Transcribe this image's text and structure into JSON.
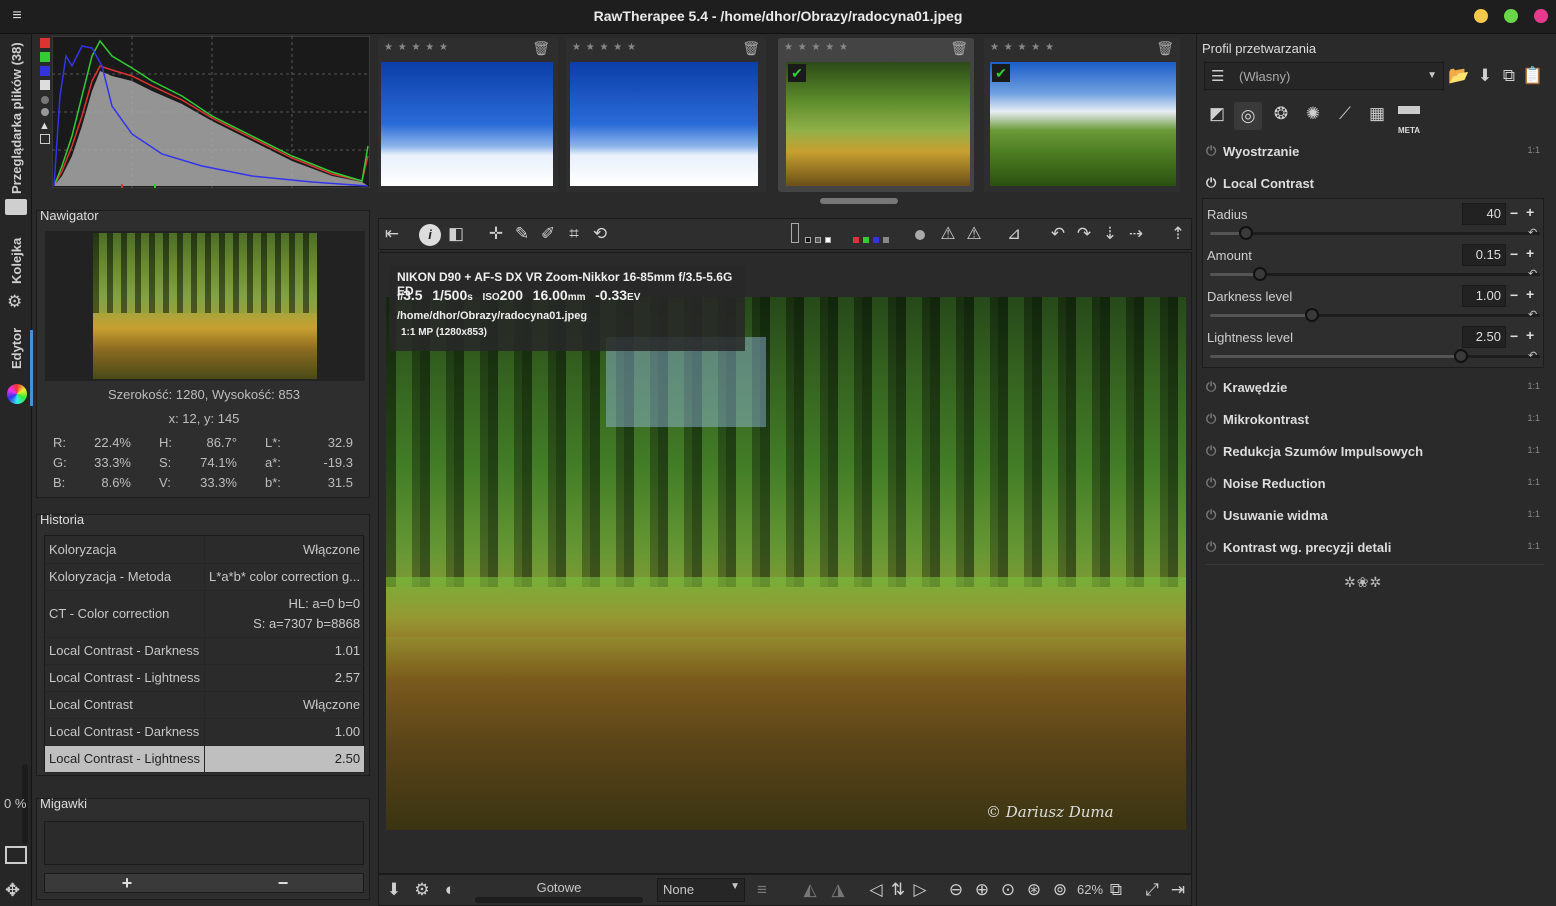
{
  "window": {
    "title": "RawTherapee 5.4 - /home/dhor/Obrazy/radocyna01.jpeg"
  },
  "left_tabs": {
    "browser": "Przeglądarka plików (38)",
    "queue": "Kolejka",
    "editor": "Edytor",
    "progress": "0 %"
  },
  "navigator": {
    "title": "Nawigator",
    "size": "Szerokość: 1280, Wysokość: 853",
    "coords": "x: 12, y: 145",
    "rows": [
      {
        "k1": "R:",
        "v1": "22.4%",
        "k2": "H:",
        "v2": "86.7°",
        "k3": "L*:",
        "v3": "32.9"
      },
      {
        "k1": "G:",
        "v1": "33.3%",
        "k2": "S:",
        "v2": "74.1%",
        "k3": "a*:",
        "v3": "-19.3"
      },
      {
        "k1": "B:",
        "v1": "8.6%",
        "k2": "V:",
        "v2": "33.3%",
        "k3": "b*:",
        "v3": "31.5"
      }
    ]
  },
  "history": {
    "title": "Historia",
    "items": [
      {
        "name": "Koloryzacja",
        "value": "Włączone"
      },
      {
        "name": "Koloryzacja - Metoda",
        "value": "L*a*b* color correction g..."
      },
      {
        "name": "CT - Color correction",
        "value": "HL: a=0 b=0",
        "value2": "S: a=7307 b=8868"
      },
      {
        "name": "Local Contrast - Darkness",
        "value": "1.01"
      },
      {
        "name": "Local Contrast - Lightness",
        "value": "2.57"
      },
      {
        "name": "Local Contrast",
        "value": "Włączone"
      },
      {
        "name": "Local Contrast - Darkness",
        "value": "1.00"
      },
      {
        "name": "Local Contrast - Lightness",
        "value": "2.50"
      }
    ]
  },
  "snapshots": {
    "title": "Migawki",
    "add": "+",
    "remove": "−"
  },
  "image_info": {
    "camera": "NIKON D90 + AF-S DX VR Zoom-Nikkor 16-85mm f/3.5-5.6G ED",
    "f_prefix": "f/",
    "aperture": "3.5",
    "shutter": "1/500",
    "shutter_unit": "s",
    "iso_prefix": "ISO",
    "iso": "200",
    "focal": "16.00",
    "focal_unit": "mm",
    "ev": "-0.33",
    "ev_unit": "EV",
    "path": "/home/dhor/Obrazy/radocyna01.jpeg",
    "mp": "1:1 MP (1280x853)"
  },
  "watermark": "© Dariusz Duma",
  "bottom_bar": {
    "status": "Gotowe",
    "select": "None",
    "zoom": "62%"
  },
  "right_panel": {
    "profile_title": "Profil przetwarzania",
    "profile_value": "(Własny)",
    "tools": [
      {
        "label": "Wyostrzanie",
        "scale": "1:1"
      },
      {
        "label": "Local Contrast"
      },
      {
        "label": "Krawędzie",
        "scale": "1:1"
      },
      {
        "label": "Mikrokontrast",
        "scale": "1:1"
      },
      {
        "label": "Redukcja Szumów Impulsowych",
        "scale": "1:1"
      },
      {
        "label": "Noise Reduction",
        "scale": "1:1"
      },
      {
        "label": "Usuwanie widma",
        "scale": "1:1"
      },
      {
        "label": "Kontrast wg. precyzji detali",
        "scale": "1:1"
      }
    ],
    "sliders": [
      {
        "label": "Radius",
        "value": "40",
        "fraction": 0.11
      },
      {
        "label": "Amount",
        "value": "0.15",
        "fraction": 0.15
      },
      {
        "label": "Darkness level",
        "value": "1.00",
        "fraction": 0.31
      },
      {
        "label": "Lightness level",
        "value": "2.50",
        "fraction": 0.76
      }
    ],
    "meta_label": "META"
  },
  "colors": {
    "accent": "#4a8fd6",
    "bg": "#2a2a2a",
    "panel": "#333333"
  }
}
